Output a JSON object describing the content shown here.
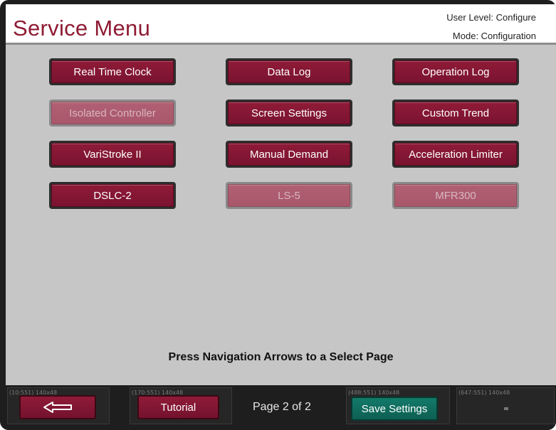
{
  "header": {
    "title": "Service Menu",
    "user_level": "User Level: Configure",
    "mode": "Mode: Configuration"
  },
  "menu_buttons": [
    {
      "label": "Real Time Clock",
      "enabled": true
    },
    {
      "label": "Data Log",
      "enabled": true
    },
    {
      "label": "Operation Log",
      "enabled": true
    },
    {
      "label": "Isolated Controller",
      "enabled": false
    },
    {
      "label": "Screen Settings",
      "enabled": true
    },
    {
      "label": "Custom Trend",
      "enabled": true
    },
    {
      "label": "VariStroke II",
      "enabled": true
    },
    {
      "label": "Manual Demand",
      "enabled": true
    },
    {
      "label": "Acceleration Limiter",
      "enabled": true
    },
    {
      "label": "DSLC-2",
      "enabled": true
    },
    {
      "label": "LS-5",
      "enabled": false
    },
    {
      "label": "MFR300",
      "enabled": false
    }
  ],
  "hint": "Press Navigation Arrows to a Select Page",
  "footer": {
    "slot_tags": [
      "(10:551) 140x48",
      "(170:551) 140x48",
      "(488:551) 140x48",
      "(647:551) 140x48"
    ],
    "back_icon": "left-arrow-icon",
    "tutorial_label": "Tutorial",
    "page_indicator": "Page 2 of 2",
    "save_label": "Save Settings"
  },
  "colors": {
    "accent": "#8e1b33",
    "save_green": "#137a6a",
    "background": "#c6c6c6"
  }
}
